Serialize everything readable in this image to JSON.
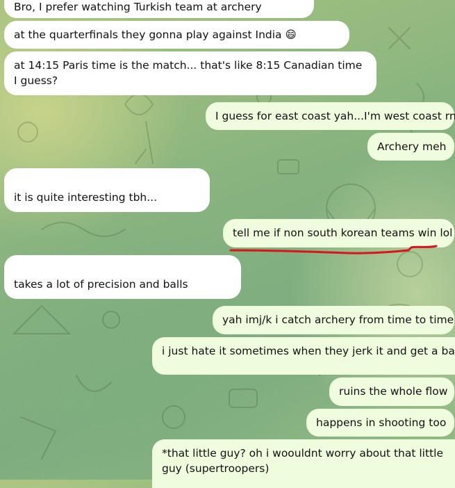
{
  "messages": [
    {
      "id": "m1",
      "side": "in",
      "text": "Bro, I prefer watching Turkish team at archery"
    },
    {
      "id": "m2",
      "side": "in",
      "text": "at the quarterfinals they gonna play against India 😄"
    },
    {
      "id": "m3",
      "side": "in",
      "text": "at 14:15 Paris time is the match... that's like 8:15 Canadian time I guess?"
    },
    {
      "id": "m4",
      "side": "out",
      "text": "I guess for east coast yah...I'm west coast rn"
    },
    {
      "id": "m5",
      "side": "out",
      "text": "Archery meh"
    },
    {
      "id": "m6",
      "side": "in",
      "text": "it is quite interesting tbh..."
    },
    {
      "id": "m7",
      "side": "out",
      "text": "tell me if non south korean teams win lol"
    },
    {
      "id": "m8",
      "side": "in",
      "text": "takes a lot of precision and balls"
    },
    {
      "id": "m9",
      "side": "out",
      "text": "yah imj/k i catch archery from time to time"
    },
    {
      "id": "m10",
      "side": "out",
      "text": "i just hate it sometimes when they jerk it and get a bad s"
    },
    {
      "id": "m11",
      "side": "out",
      "text": "ruins the whole flow"
    },
    {
      "id": "m12",
      "side": "out",
      "text": "happens in shooting too"
    },
    {
      "id": "m13",
      "side": "out",
      "text": "*that little guy? oh i woouldnt worry about that little guy (supertroopers)"
    }
  ],
  "colors": {
    "incoming_bubble": "#ffffff",
    "outgoing_bubble": "#effdde",
    "annotation_underline": "#d8141e"
  }
}
